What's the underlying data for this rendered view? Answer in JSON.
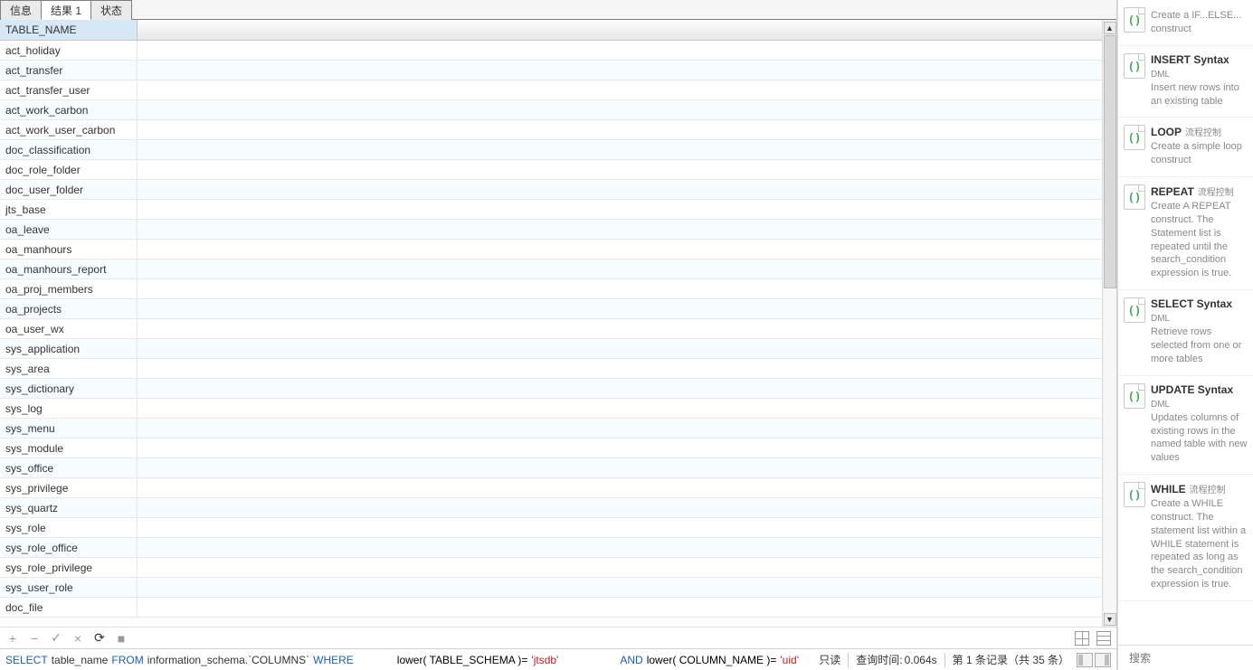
{
  "tabs": [
    {
      "label": "信息",
      "active": false
    },
    {
      "label": "结果 1",
      "active": true
    },
    {
      "label": "状态",
      "active": false
    }
  ],
  "grid": {
    "header": "TABLE_NAME",
    "current_row_marker": "▶",
    "rows": [
      "act_holiday",
      "act_transfer",
      "act_transfer_user",
      "act_work_carbon",
      "act_work_user_carbon",
      "doc_classification",
      "doc_role_folder",
      "doc_user_folder",
      "jts_base",
      "oa_leave",
      "oa_manhours",
      "oa_manhours_report",
      "oa_proj_members",
      "oa_projects",
      "oa_user_wx",
      "sys_application",
      "sys_area",
      "sys_dictionary",
      "sys_log",
      "sys_menu",
      "sys_module",
      "sys_office",
      "sys_privilege",
      "sys_quartz",
      "sys_role",
      "sys_role_office",
      "sys_role_privilege",
      "sys_user_role",
      "doc_file"
    ]
  },
  "toolbar": {
    "add": "+",
    "remove": "−",
    "check": "✓",
    "close": "×",
    "refresh": "⟳",
    "stop": "■"
  },
  "sql": {
    "select_kw": "SELECT",
    "from_kw": "FROM",
    "where_kw": "WHERE",
    "and_kw": "AND",
    "field": "table_name",
    "table": "information_schema.`COLUMNS`",
    "fn1": "lower( TABLE_SCHEMA )=",
    "val1": "'jtsdb'",
    "fn2": "lower( COLUMN_NAME )=",
    "val2": "'uid'"
  },
  "status": {
    "readonly": "只读",
    "query_time_label": "查询时间:",
    "query_time_value": "0.064s",
    "record_info": "第 1 条记录（共 35 条）"
  },
  "help": {
    "items": [
      {
        "title": "",
        "tag": "",
        "desc": "Create a IF...ELSE... construct"
      },
      {
        "title": "INSERT Syntax",
        "tag": "DML",
        "desc": "Insert new rows into an existing table"
      },
      {
        "title": "LOOP",
        "tag": "流程控制",
        "desc": "Create a simple loop construct"
      },
      {
        "title": "REPEAT",
        "tag": "流程控制",
        "desc": "Create A REPEAT construct. The Statement list is repeated until the search_condition expression is true."
      },
      {
        "title": "SELECT Syntax",
        "tag": "DML",
        "desc": "Retrieve rows selected from one or more tables"
      },
      {
        "title": "UPDATE Syntax",
        "tag": "DML",
        "desc": "Updates columns of existing rows in the named table with new values"
      },
      {
        "title": "WHILE",
        "tag": "流程控制",
        "desc": "Create a WHILE construct. The statement list within a WHILE statement is repeated as long as the search_condition expression is true."
      }
    ],
    "search_placeholder": "搜索"
  }
}
